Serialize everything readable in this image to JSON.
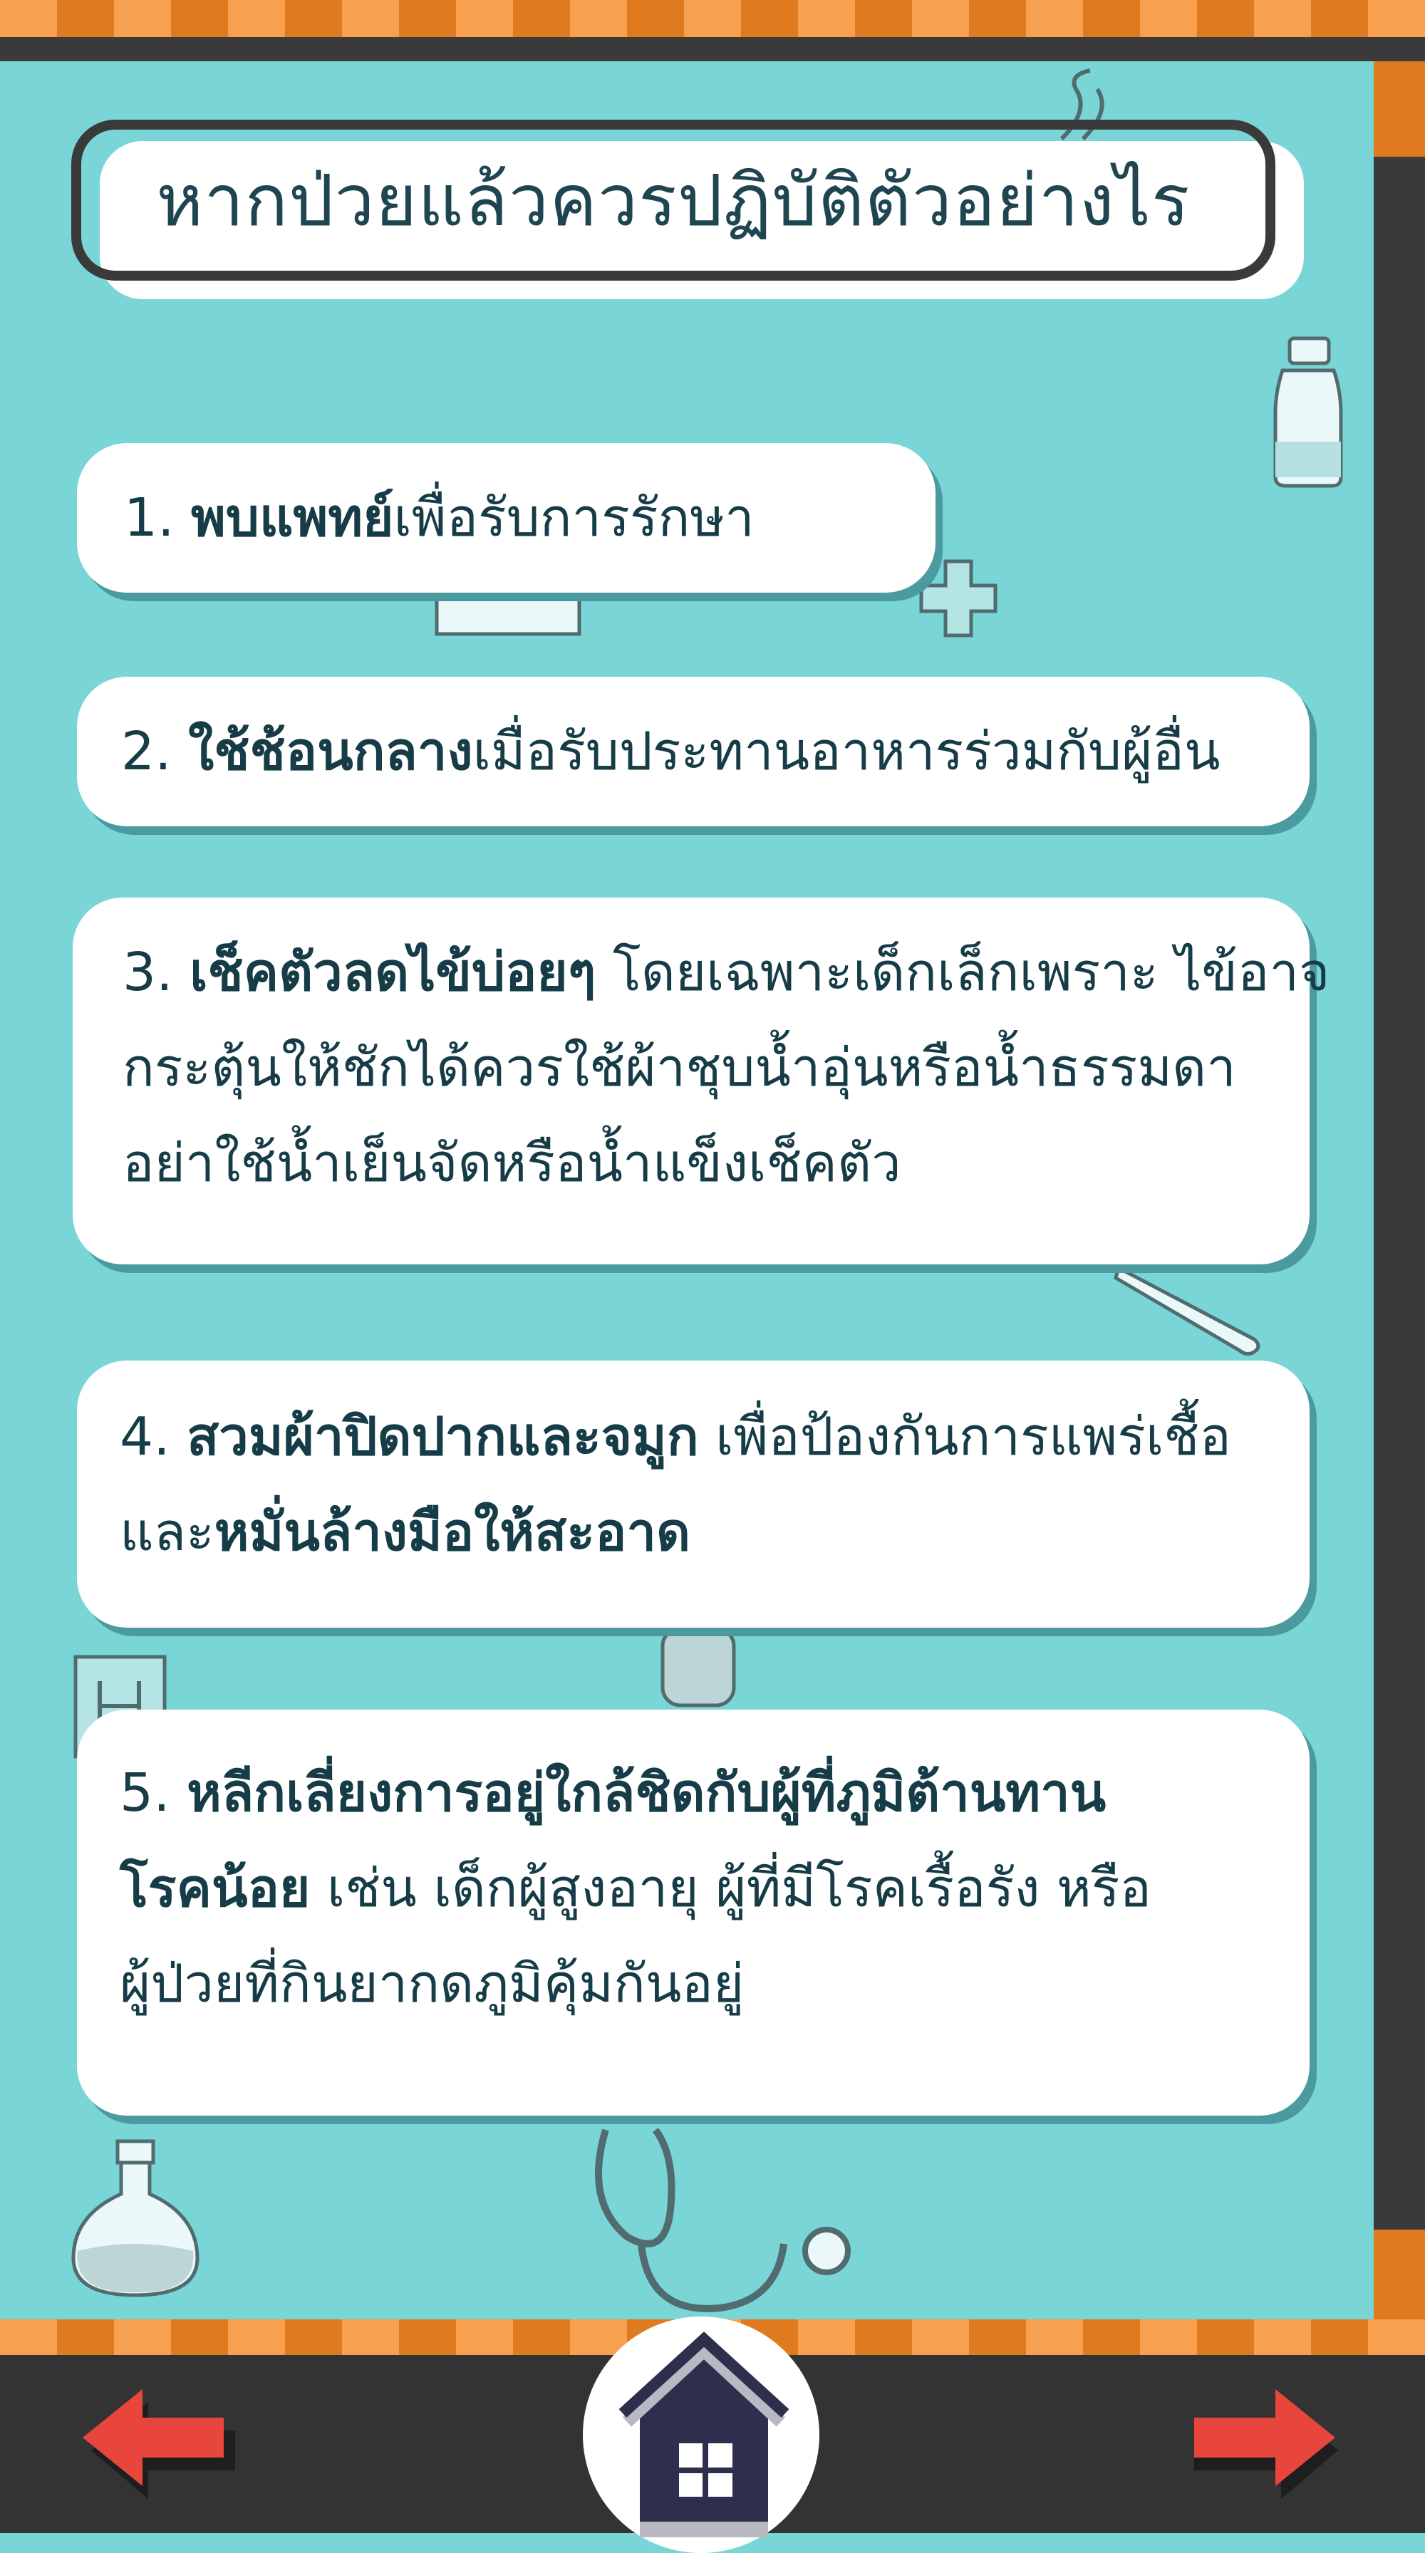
{
  "title": "หากป่วยแล้วควรปฏิบัติตัวอย่างไร",
  "items": [
    {
      "num": "1.",
      "bold": "พบแพทย์",
      "rest": "เพื่อรับการรักษา"
    },
    {
      "num": "2.",
      "bold": "ใช้ช้อนกลาง",
      "rest": "เมื่อรับประทานอาหารร่วมกับผู้อื่น"
    },
    {
      "num": "3.",
      "bold": "เช็คตัวลดไข้บ่อยๆ",
      "rest1": " โดยเฉพาะเด็กเล็กเพราะ ไข้อาจ",
      "line2": "กระตุ้นให้ชักได้ควรใช้ผ้าชุบน้ำอุ่นหรือน้ำธรรมดา",
      "line3": "อย่าใช้น้ำเย็นจัดหรือน้ำแข็งเช็คตัว"
    },
    {
      "num": "4.",
      "bold": "สวมผ้าปิดปากและจมูก",
      "rest1": " เพื่อป้องกันการแพร่เชื้อ",
      "line2_pre": "และ",
      "line2_bold": "หมั่นล้างมือให้สะอาด"
    },
    {
      "num": "5.",
      "bold": "หลีกเลี่ยงการอยู่ใกล้ชิดกับผู้ที่ภูมิต้านทาน",
      "line2_bold": "โรคน้อย",
      "line2_rest": " เช่น เด็กผู้สูงอายุ ผู้ที่มีโรคเรื้อรัง หรือ",
      "line3": "ผู้ป่วยที่กินยากดภูมิคุ้มกันอยู่"
    }
  ],
  "nav": {
    "prev_icon": "left-arrow-icon",
    "home_icon": "home-icon",
    "next_icon": "right-arrow-icon"
  },
  "colors": {
    "background": "#7ad5d7",
    "stripe_light": "#f6a050",
    "stripe_dark": "#e07a1f",
    "frame": "#3a3a3a",
    "arrow": "#e8453c",
    "home": "#2e2f4d"
  }
}
